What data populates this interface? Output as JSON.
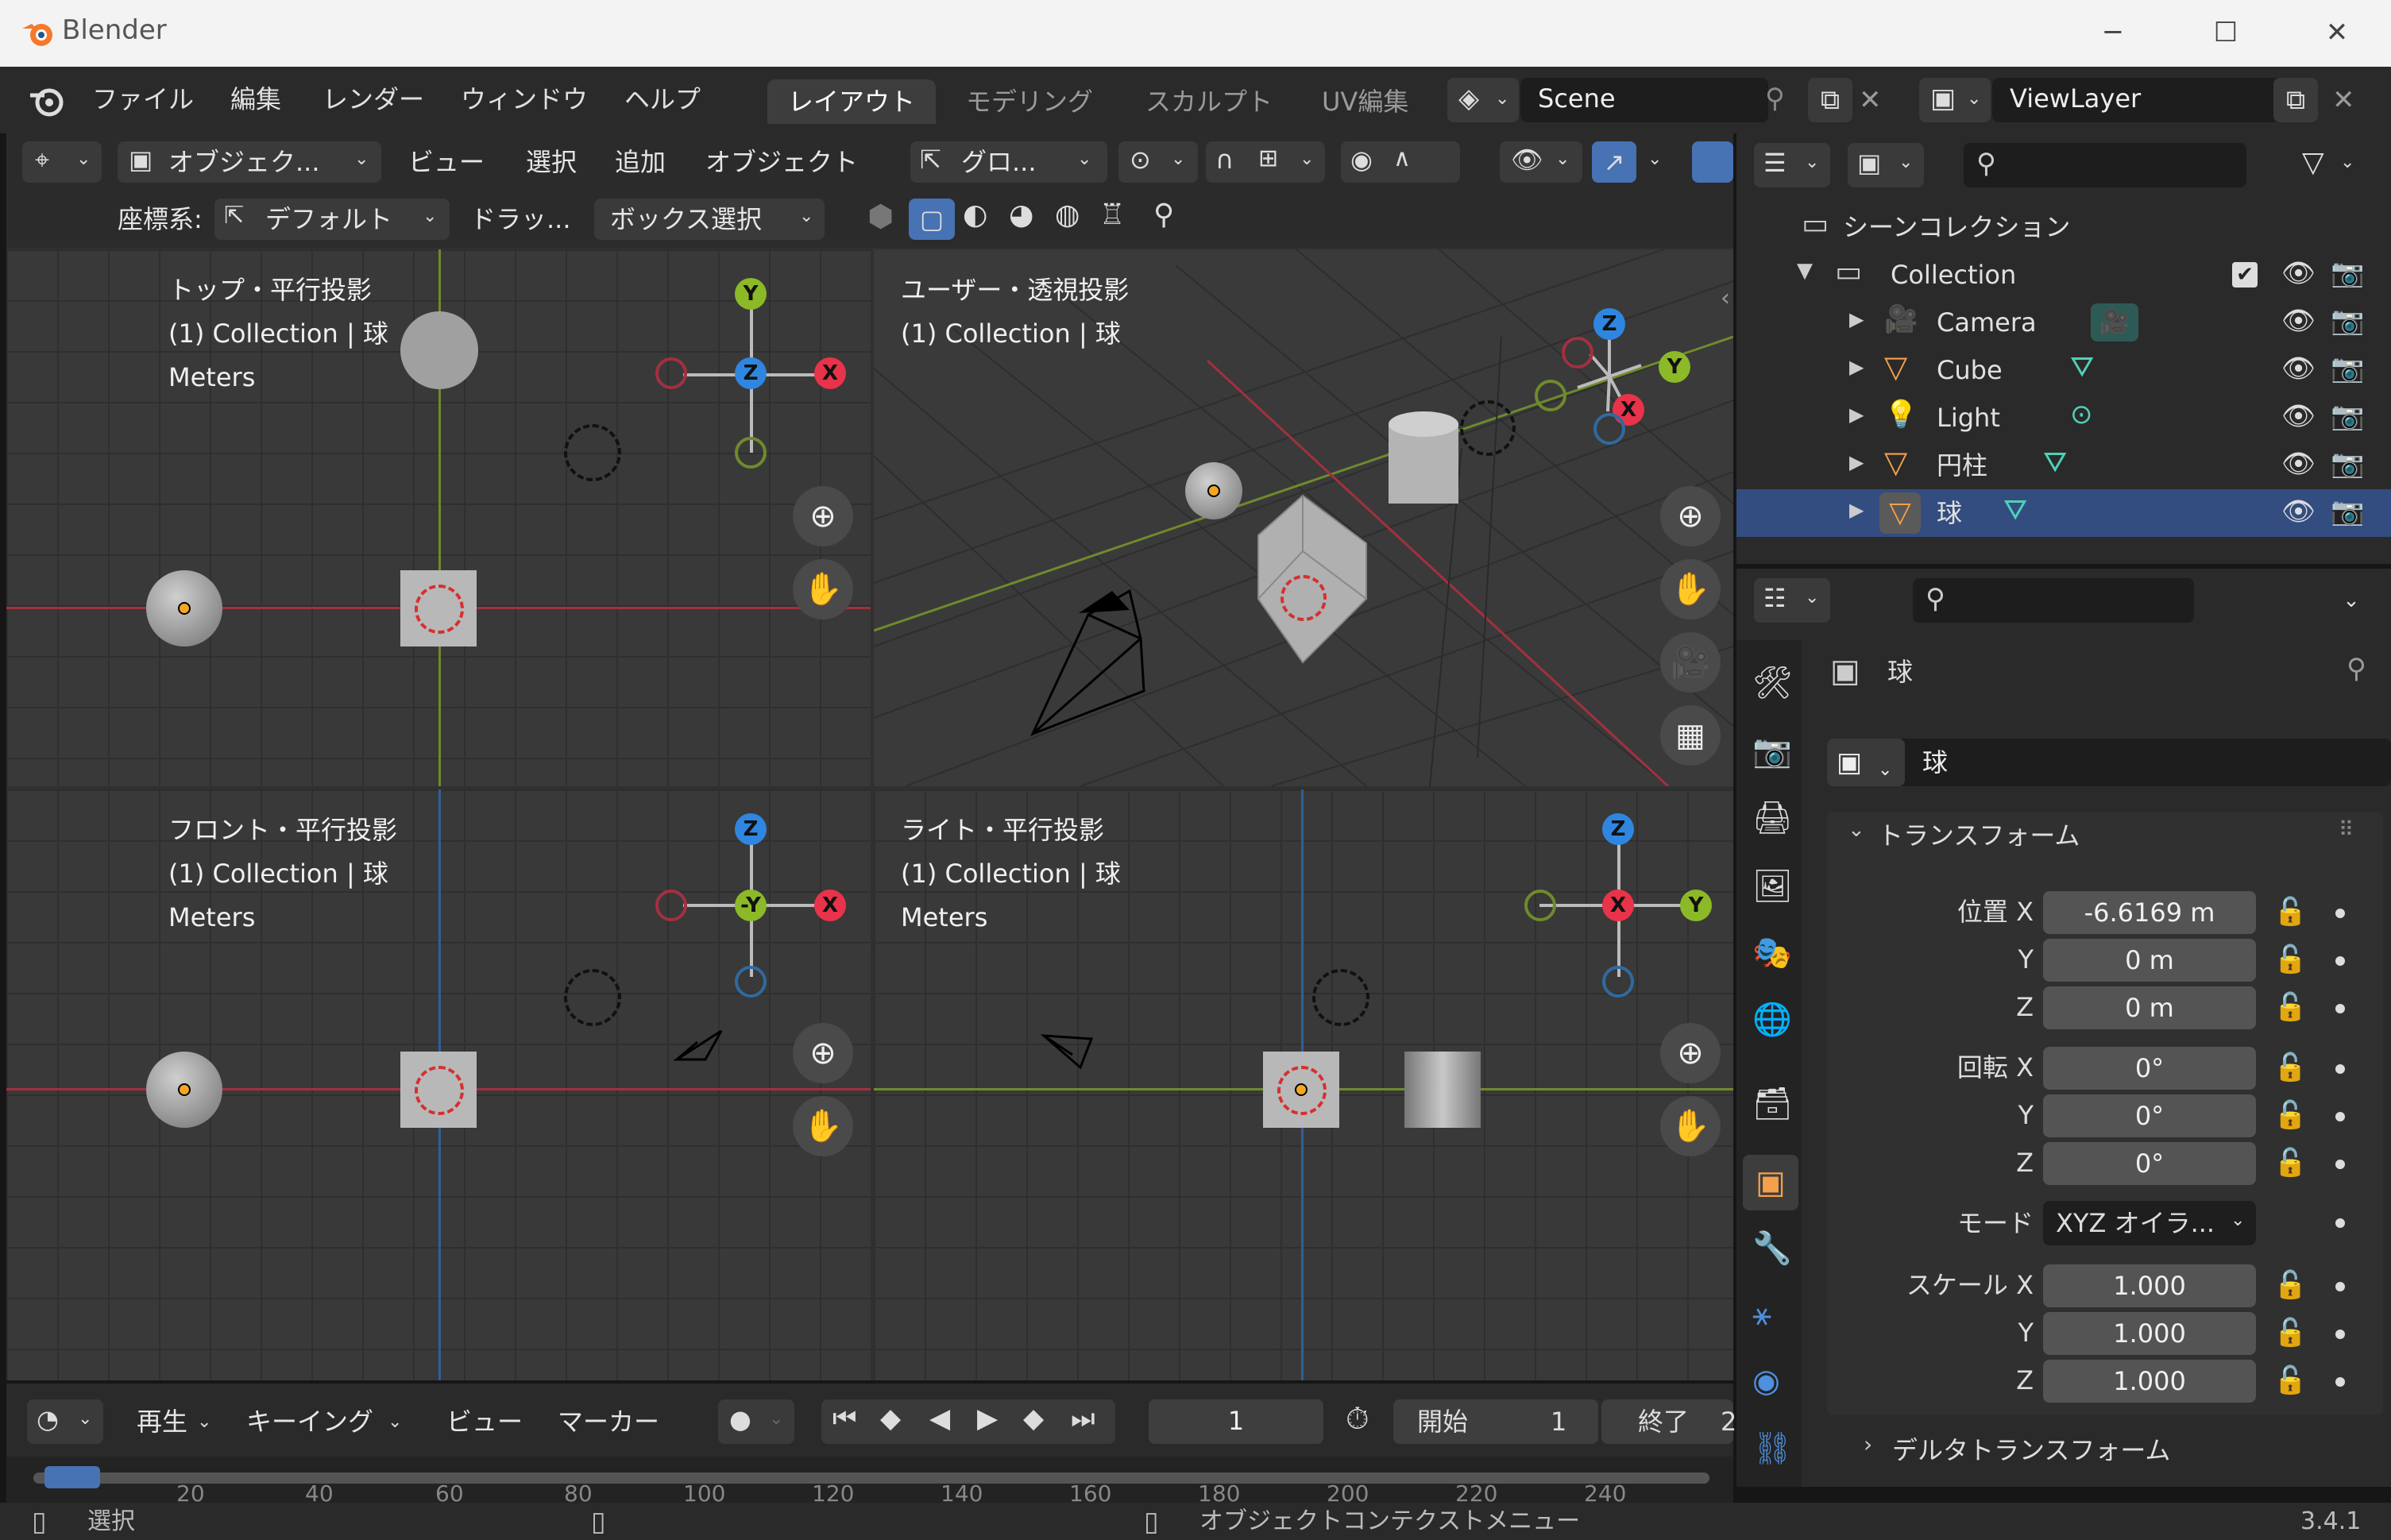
{
  "window": {
    "title": "Blender",
    "controls": [
      "─",
      "☐",
      "✕"
    ]
  },
  "topbar": {
    "menus": [
      "ファイル",
      "編集",
      "レンダー",
      "ウィンドウ",
      "ヘルプ"
    ],
    "workspaces": [
      "レイアウト",
      "モデリング",
      "スカルプト",
      "UV編集"
    ],
    "active_workspace": "レイアウト",
    "scene": "Scene",
    "view_layer": "ViewLayer"
  },
  "viewport_header": {
    "mode": "オブジェク...",
    "menus": [
      "ビュー",
      "選択",
      "追加",
      "オブジェクト"
    ],
    "transform": "グロ...",
    "coord_label": "座標系:",
    "coord_value": "デフォルト",
    "drag": "ドラッ...",
    "select_mode": "ボックス選択"
  },
  "viewports": [
    {
      "title": "トップ・平行投影",
      "subtitle": "(1) Collection | 球",
      "units": "Meters"
    },
    {
      "title": "ユーザー・透視投影",
      "subtitle": "(1) Collection | 球",
      "units": ""
    },
    {
      "title": "フロント・平行投影",
      "subtitle": "(1) Collection | 球",
      "units": "Meters"
    },
    {
      "title": "ライト・平行投影",
      "subtitle": "(1) Collection | 球",
      "units": "Meters"
    }
  ],
  "gizmo_labels": {
    "x": "X",
    "y": "Y",
    "z": "Z",
    "neg_y": "-Y"
  },
  "colors": {
    "x": "#e8334a",
    "y": "#8bb928",
    "z": "#2f86e0",
    "active": "#4772b3"
  },
  "outliner": {
    "root": "シーンコレクション",
    "collection": "Collection",
    "items": [
      {
        "name": "Camera",
        "icon": "camera-icon"
      },
      {
        "name": "Cube",
        "icon": "mesh-icon"
      },
      {
        "name": "Light",
        "icon": "light-icon"
      },
      {
        "name": "円柱",
        "icon": "mesh-icon"
      },
      {
        "name": "球",
        "icon": "mesh-icon"
      }
    ]
  },
  "properties": {
    "object_name": "球",
    "name_field": "球",
    "section": "トランスフォーム",
    "location_label": "位置 X",
    "location": [
      "-6.6169 m",
      "0 m",
      "0 m"
    ],
    "rotation_label": "回転 X",
    "rotation": [
      "0°",
      "0°",
      "0°"
    ],
    "axis_y": "Y",
    "axis_z": "Z",
    "mode_label": "モード",
    "mode_value": "XYZ オイラ...",
    "scale_label": "スケール X",
    "scale": [
      "1.000",
      "1.000",
      "1.000"
    ],
    "delta": "デルタトランスフォーム"
  },
  "timeline": {
    "play": "再生",
    "keying": "キーイング",
    "view": "ビュー",
    "marker": "マーカー",
    "frame": "1",
    "start_label": "開始",
    "start": "1",
    "end_label": "終了",
    "end": "2",
    "ticks": [
      "20",
      "40",
      "60",
      "80",
      "100",
      "120",
      "140",
      "160",
      "180",
      "200",
      "220",
      "240"
    ]
  },
  "status": {
    "select": "選択",
    "context_menu": "オブジェクトコンテクストメニュー",
    "version": "3.4.1"
  }
}
